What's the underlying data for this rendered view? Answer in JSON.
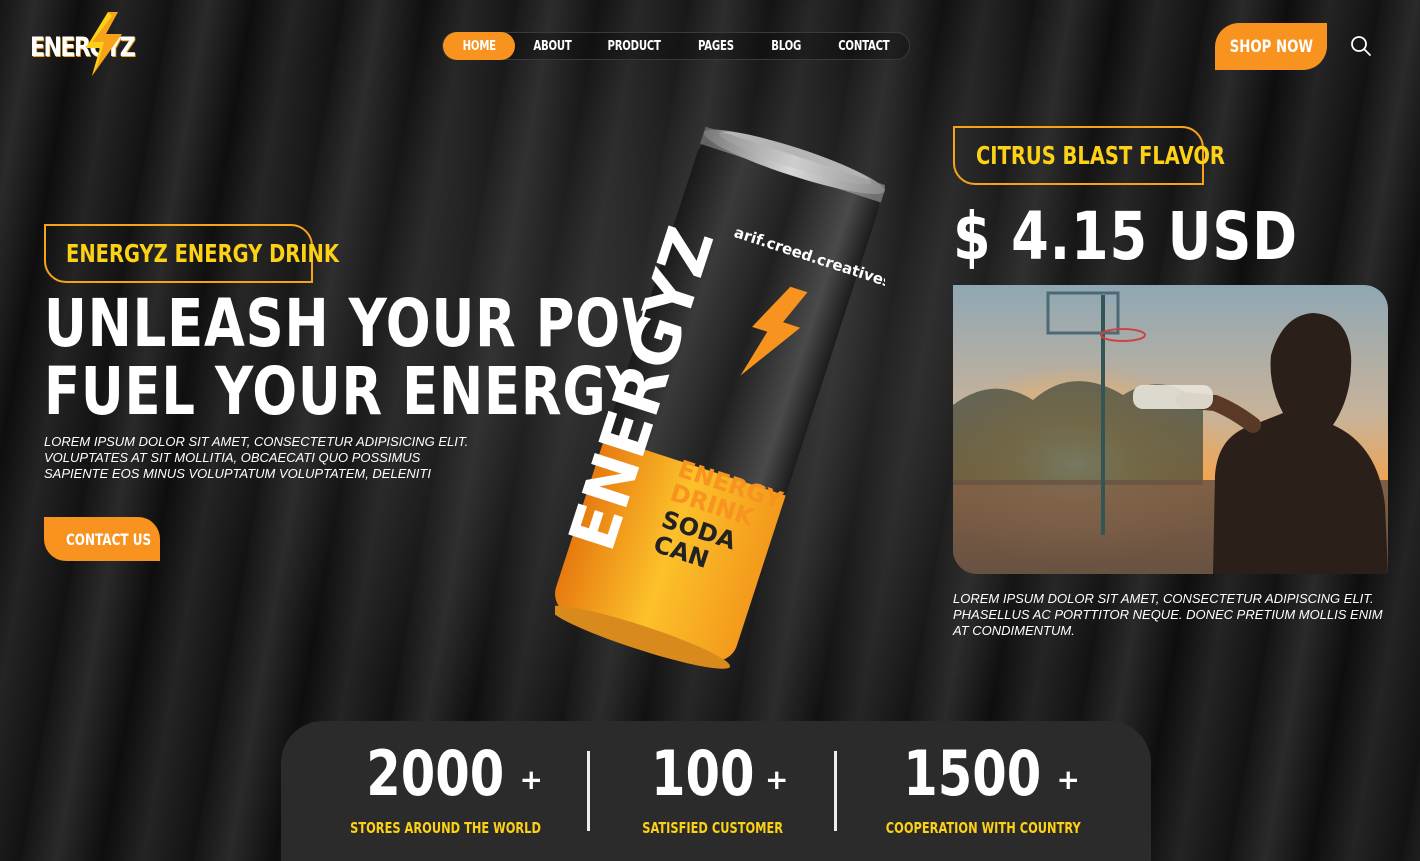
{
  "header": {
    "logo_text": "ENERGYZ",
    "nav": [
      {
        "label": "HOME",
        "active": true
      },
      {
        "label": "ABOUT",
        "active": false
      },
      {
        "label": "PRODUCT",
        "active": false
      },
      {
        "label": "PAGES",
        "active": false
      },
      {
        "label": "BLOG",
        "active": false
      },
      {
        "label": "CONTACT",
        "active": false
      }
    ],
    "shop_label": "SHOP NOW",
    "search_icon": "search-icon"
  },
  "hero": {
    "tag": "ENERGYZ ENERGY DRINK",
    "headline_line1": "UNLEASH YOUR POWER,",
    "headline_line2": "FUEL YOUR ENERGY",
    "description": "LOREM IPSUM DOLOR SIT AMET, CONSECTETUR ADIPISICING ELIT. VOLUPTATES AT SIT MOLLITIA, OBCAECATI QUO POSSIMUS SAPIENTE EOS MINUS VOLUPTATUM VOLUPTATEM, DELENITI",
    "cta_label": "CONTACT US"
  },
  "can": {
    "credit": "arif.creed.creatives",
    "brand": "ENERGYZ",
    "line1": "ENERGY",
    "line2": "DRINK",
    "line3": "SODA",
    "line4": "CAN"
  },
  "flavor": {
    "tag": "CITRUS BLAST FLAVOR",
    "price": "$ 4.15 USD",
    "description": "LOREM IPSUM DOLOR SIT AMET, CONSECTETUR ADIPISCING ELIT. PHASELLUS AC PORTTITOR NEQUE. DONEC PRETIUM MOLLIS ENIM AT CONDIMENTUM."
  },
  "stats": [
    {
      "value": "2000",
      "suffix": "+",
      "label": "STORES AROUND THE WORLD"
    },
    {
      "value": "100",
      "suffix": "+",
      "label": "SATISFIED CUSTOMER"
    },
    {
      "value": "1500",
      "suffix": "+",
      "label": "COOPERATION WITH COUNTRY"
    }
  ],
  "colors": {
    "accent_orange": "#f7931e",
    "accent_yellow": "#fcd116",
    "background": "#141414",
    "stats_panel": "#2b2b2b"
  }
}
